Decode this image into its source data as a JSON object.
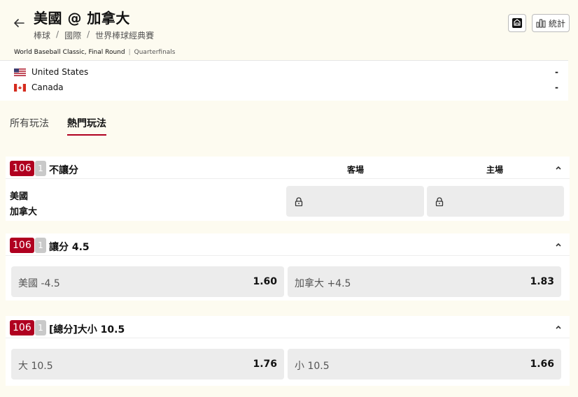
{
  "header": {
    "title": "美國 @ 加拿大",
    "breadcrumb": [
      "棒球",
      "國際",
      "世界棒球經典賽"
    ],
    "stats_label": "統計"
  },
  "tournament": {
    "name": "World Baseball Classic, Final Round",
    "round": "Quarterfinals"
  },
  "teams": [
    {
      "name": "United States",
      "score": "-"
    },
    {
      "name": "Canada",
      "score": "-"
    }
  ],
  "tabs": [
    {
      "label": "所有玩法",
      "active": false
    },
    {
      "label": "熱門玩法",
      "active": true
    }
  ],
  "markets": [
    {
      "id": "106",
      "count": "1",
      "title": "不讓分",
      "col_away": "客場",
      "col_home": "主場",
      "rows": [
        "美國",
        "加拿大"
      ]
    },
    {
      "id": "106",
      "count": "1",
      "title": "讓分 4.5",
      "options": [
        {
          "label": "美國 -4.5",
          "odds": "1.60"
        },
        {
          "label": "加拿大 +4.5",
          "odds": "1.83"
        }
      ]
    },
    {
      "id": "106",
      "count": "1",
      "title": "[總分]大小 10.5",
      "options": [
        {
          "label": "大 10.5",
          "odds": "1.76"
        },
        {
          "label": "小 10.5",
          "odds": "1.66"
        }
      ]
    }
  ]
}
